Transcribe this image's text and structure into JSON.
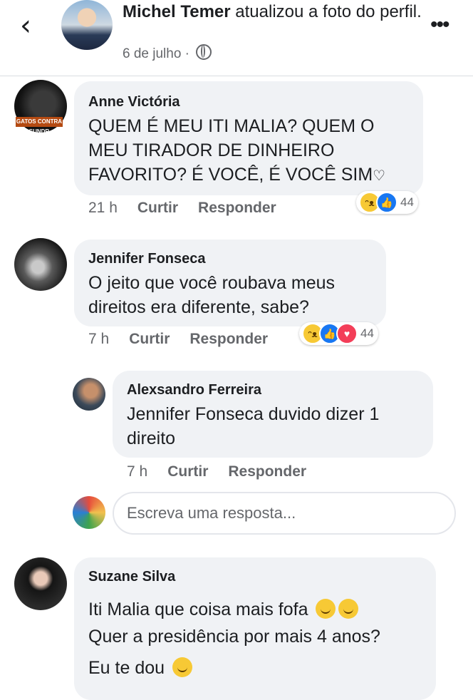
{
  "header": {
    "back_icon": "chevron-left-icon",
    "author": "Michel Temer",
    "action": " atualizou a foto do perfil.",
    "date": "6 de julho · ",
    "privacy_icon": "globe-icon",
    "more_icon": "more-dots-icon"
  },
  "comments": [
    {
      "name": "Anne Victória",
      "text": "QUEM É MEU ITI MALIA? QUEM O MEU TIRADOR DE DINHEIRO FAVORITO? É VOCÊ, É VOCÊ SIM",
      "avatar_tag": "GATOS CONTRA SUNDR",
      "time": "21 h",
      "like": "Curtir",
      "reply": "Responder",
      "reactions": [
        "haha",
        "like"
      ],
      "reaction_count": "44"
    },
    {
      "name": "Jennifer Fonseca",
      "text": "O jeito que você roubava meus direitos era diferente, sabe?",
      "time": "7 h",
      "like": "Curtir",
      "reply": "Responder",
      "reactions": [
        "haha",
        "like",
        "love"
      ],
      "reaction_count": "44"
    },
    {
      "name": "Alexsandro Ferreira",
      "text": "Jennifer Fonseca  duvido dizer 1 direito",
      "time": "7 h",
      "like": "Curtir",
      "reply": "Responder"
    },
    {
      "name": "Suzane Silva",
      "line1": "Iti Malia que coisa mais fofa",
      "line2": "Quer a presidência por mais 4 anos?",
      "line3": "Eu te dou"
    }
  ],
  "reply_box": {
    "placeholder": "Escreva uma resposta..."
  }
}
